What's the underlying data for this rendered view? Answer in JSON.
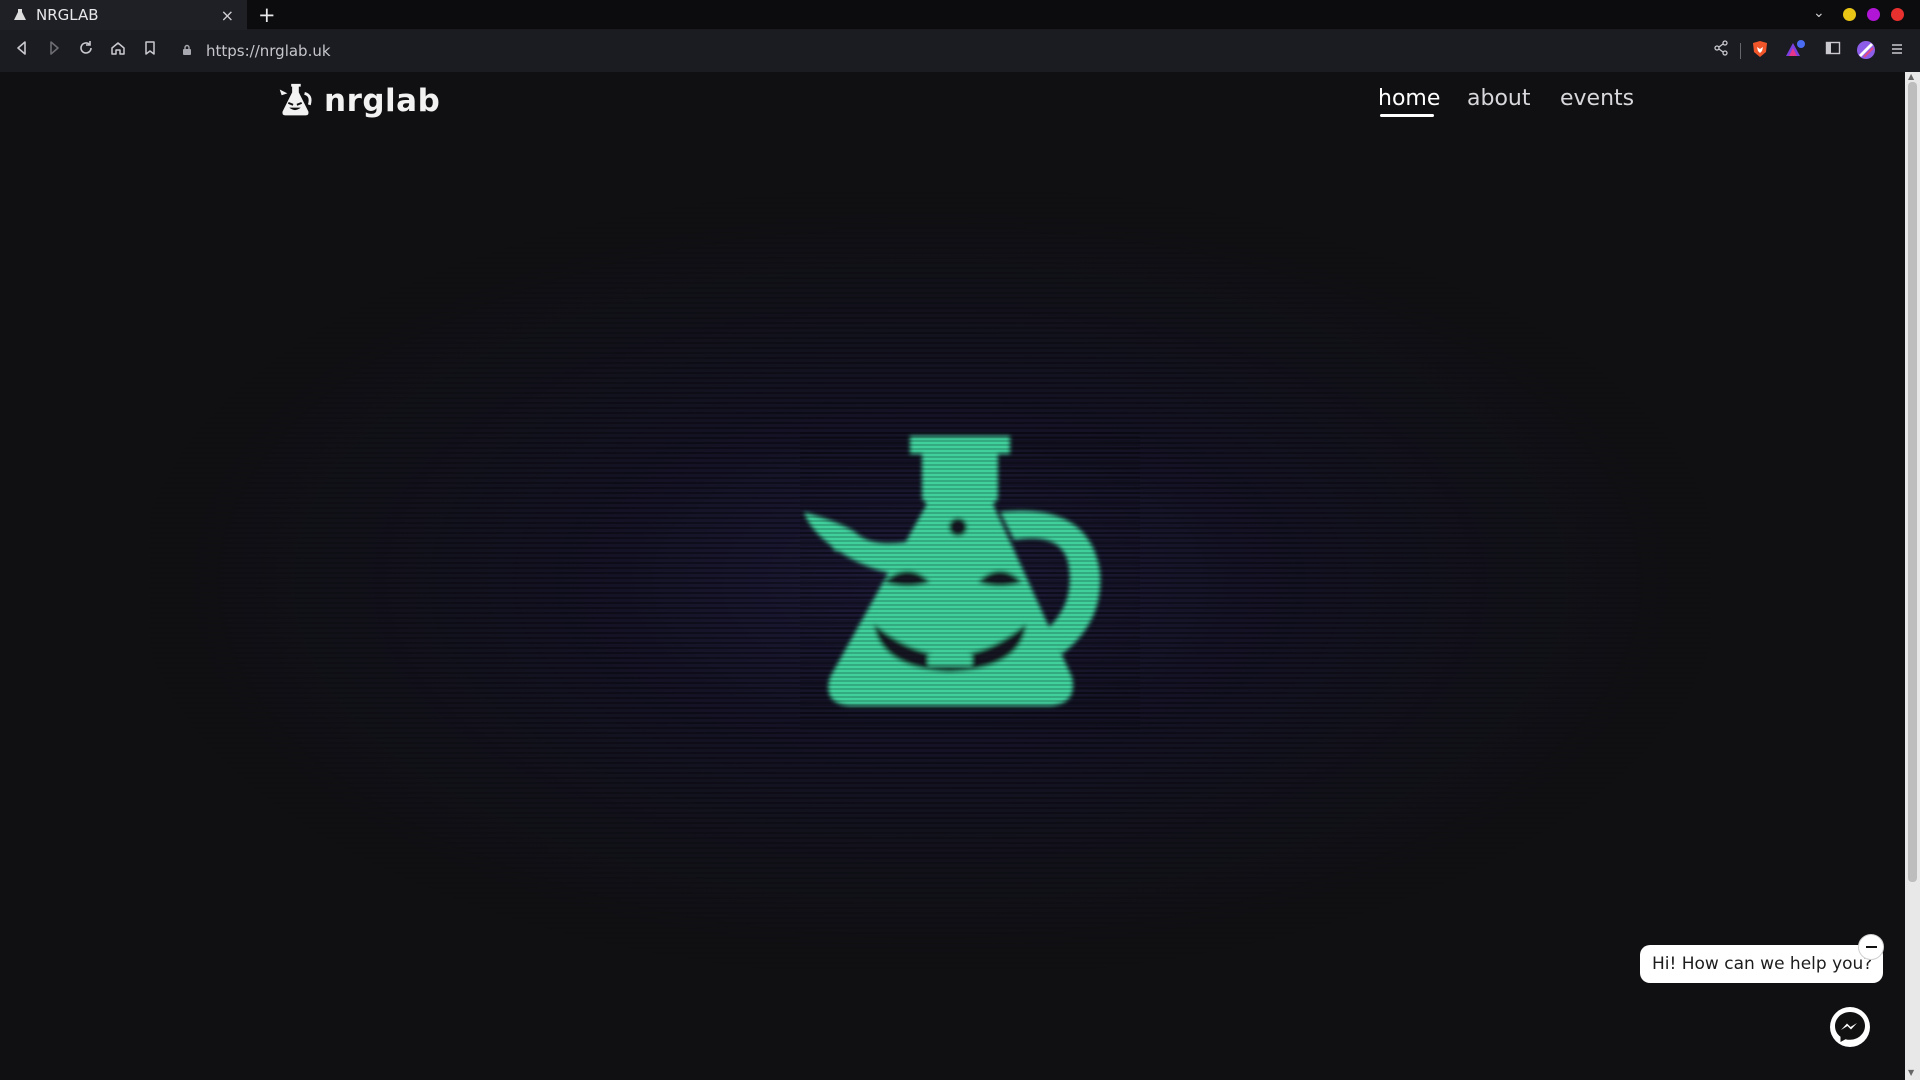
{
  "browser": {
    "tab_title": "NRGLAB",
    "url": "https://nrglab.uk",
    "window_dots": [
      "#e9c516",
      "#b116d6",
      "#e8302f"
    ]
  },
  "site": {
    "brand_name": "nrglab",
    "nav": [
      {
        "label": "home",
        "active": true
      },
      {
        "label": "about",
        "active": false
      },
      {
        "label": "events",
        "active": false
      }
    ],
    "hero_color": "#3fd09c",
    "background": "#101012"
  },
  "chat": {
    "greeting": "Hi! How can we help you?"
  },
  "icons": {
    "tab": "flask-logo-icon",
    "toolbar": [
      "back-arrow-icon",
      "forward-arrow-icon",
      "reload-icon",
      "home-icon",
      "bookmark-icon",
      "lock-icon",
      "share-icon",
      "brave-shield-icon",
      "brave-rewards-icon",
      "sidebar-icon",
      "profile-icon",
      "menu-icon"
    ],
    "chat": [
      "minimize-icon",
      "messenger-icon"
    ]
  }
}
